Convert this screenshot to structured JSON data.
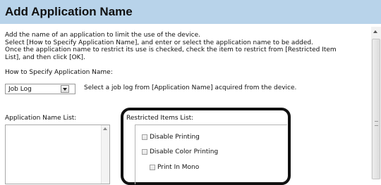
{
  "header": {
    "title": "Add Application Name"
  },
  "description": {
    "lines": [
      "Add the name of an application to limit the use of the device.",
      "Select [How to Specify Application Name], and enter or select the application name to be added.",
      "Once the application name to restrict its use is checked, check the item to restrict from [Restricted Item",
      "List], and then click [OK]."
    ]
  },
  "how_to_specify": {
    "label": "How to Specify Application Name:",
    "selected": "Job Log",
    "hint": "Select a job log from [Application Name] acquired from the device."
  },
  "application_list": {
    "label": "Application Name List:"
  },
  "restricted_items": {
    "label": "Restricted Items List:",
    "items": [
      {
        "label": "Disable Printing",
        "checked": false
      },
      {
        "label": "Disable Color Printing",
        "checked": false
      },
      {
        "label": "Print In Mono",
        "checked": false
      }
    ]
  },
  "colors": {
    "title_bar": "#b8d3ea",
    "annotation": "#111111"
  }
}
